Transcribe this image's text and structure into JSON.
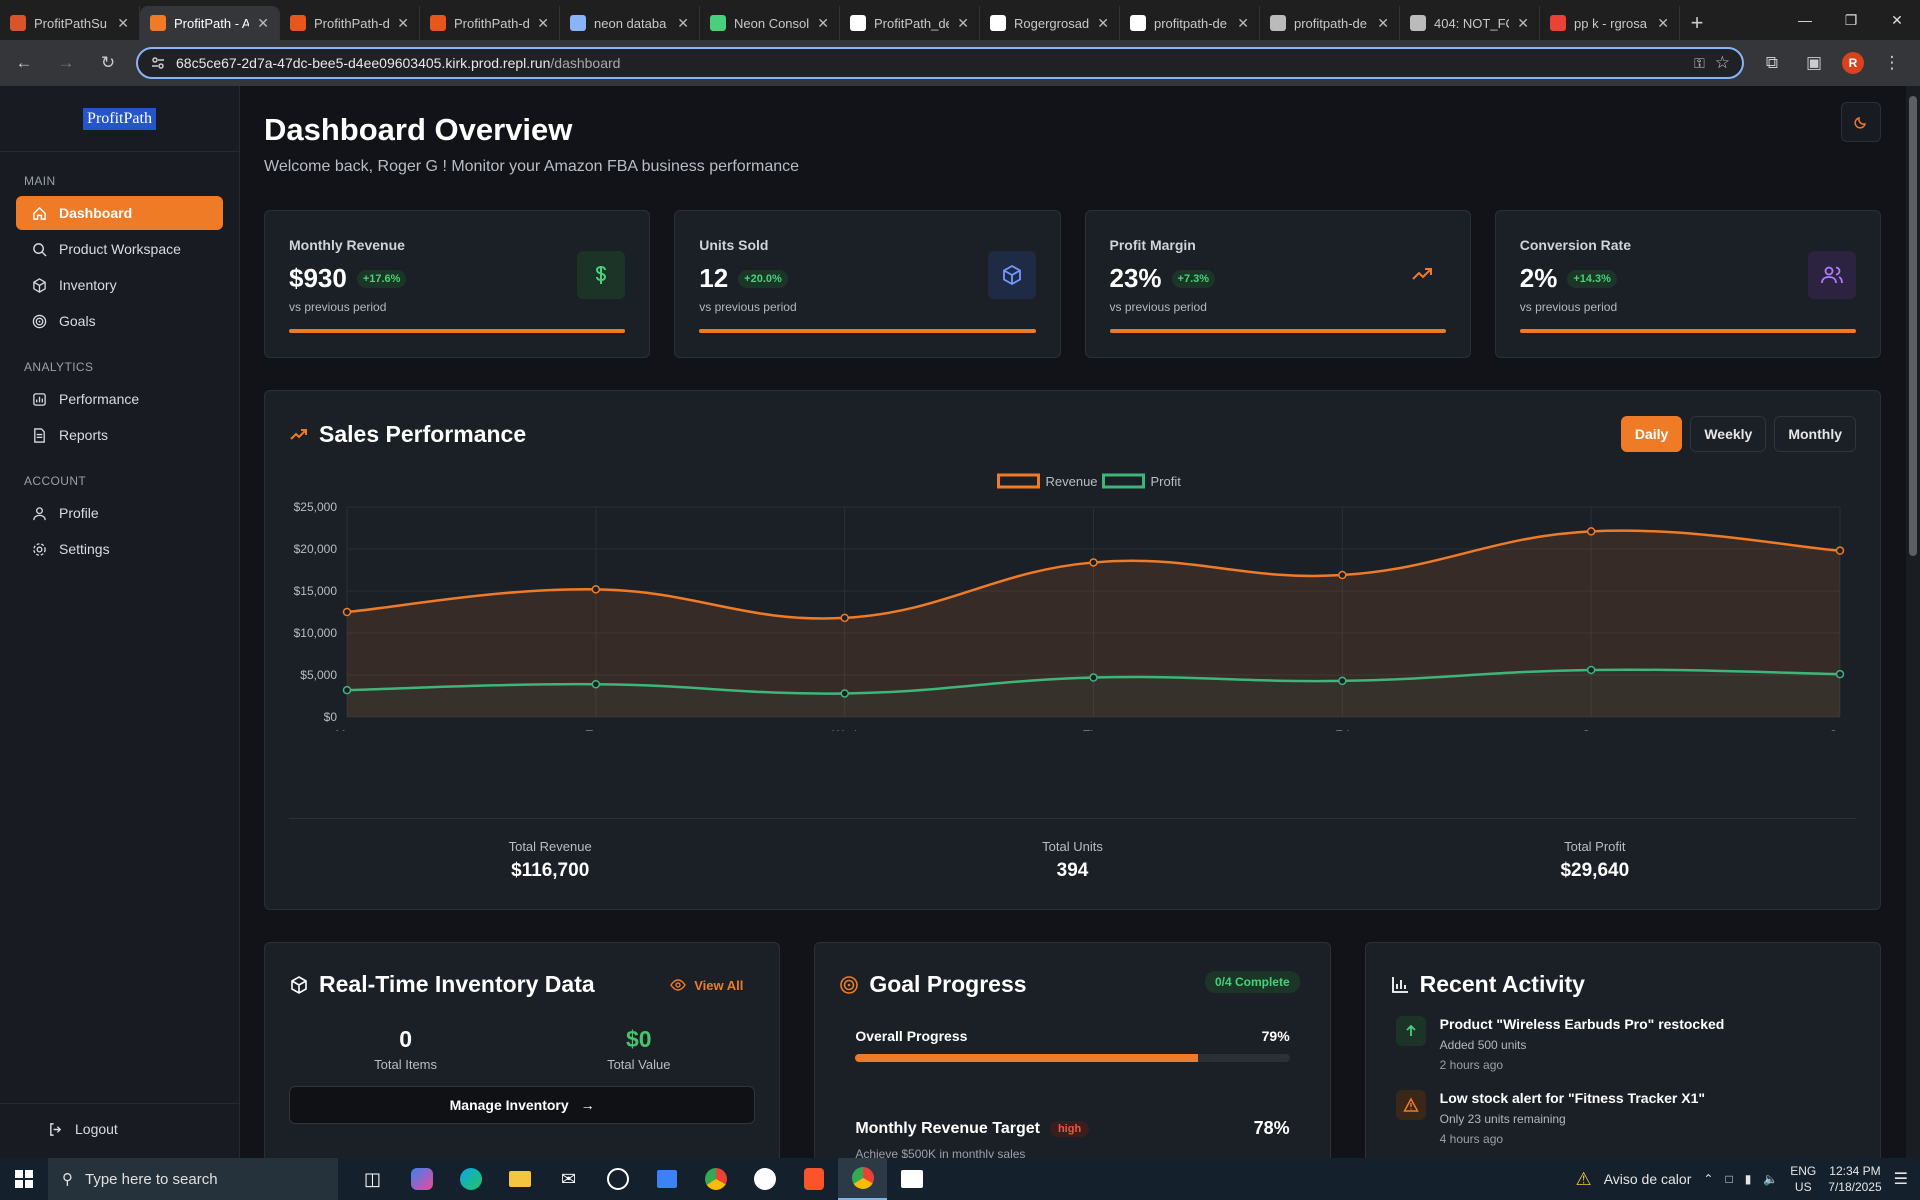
{
  "browser": {
    "tabs": [
      {
        "title": "ProfitPathSu",
        "fav": "#d9532b"
      },
      {
        "title": "ProfitPath - A",
        "fav": "#f07b27",
        "active": true
      },
      {
        "title": "ProfithPath-d",
        "fav": "#e8561b"
      },
      {
        "title": "ProfithPath-d",
        "fav": "#e8561b"
      },
      {
        "title": "neon databa",
        "fav": "#8ab4f8"
      },
      {
        "title": "Neon Consol",
        "fav": "#47d17a"
      },
      {
        "title": "ProfitPath_de",
        "fav": "#ffffff"
      },
      {
        "title": "Rogergrosad",
        "fav": "#ffffff"
      },
      {
        "title": "profitpath-de",
        "fav": "#ffffff"
      },
      {
        "title": "profitpath-de",
        "fav": "#bbbbbb"
      },
      {
        "title": "404: NOT_FO",
        "fav": "#bbbbbb"
      },
      {
        "title": "pp k - rgrosa",
        "fav": "#ea4335"
      }
    ],
    "url_host": "68c5ce67-2d7a-47dc-bee5-d4ee09603405.kirk.prod.repl.run",
    "url_path": "/dashboard",
    "profile_initial": "R"
  },
  "sidebar": {
    "logo_alt": "ProfitPath",
    "sections": [
      {
        "label": "MAIN",
        "items": [
          {
            "label": "Dashboard",
            "icon": "home-icon",
            "active": true
          },
          {
            "label": "Product Workspace",
            "icon": "search-icon"
          },
          {
            "label": "Inventory",
            "icon": "box-icon"
          },
          {
            "label": "Goals",
            "icon": "target-icon"
          }
        ]
      },
      {
        "label": "ANALYTICS",
        "items": [
          {
            "label": "Performance",
            "icon": "chart-icon"
          },
          {
            "label": "Reports",
            "icon": "document-icon"
          }
        ]
      },
      {
        "label": "ACCOUNT",
        "items": [
          {
            "label": "Profile",
            "icon": "user-icon"
          },
          {
            "label": "Settings",
            "icon": "gear-icon"
          }
        ]
      }
    ],
    "logout": "Logout"
  },
  "header": {
    "title": "Dashboard Overview",
    "subtitle": "Welcome back, Roger G ! Monitor your Amazon FBA business performance"
  },
  "stats": [
    {
      "label": "Monthly Revenue",
      "value": "$930",
      "change": "+17.6%",
      "note": "vs previous period",
      "icon": "dollar-icon",
      "icon_color": "#47d17a",
      "icon_bg": "#1c3327"
    },
    {
      "label": "Units Sold",
      "value": "12",
      "change": "+20.0%",
      "note": "vs previous period",
      "icon": "cube-icon",
      "icon_color": "#6f9bff",
      "icon_bg": "#1f2a44"
    },
    {
      "label": "Profit Margin",
      "value": "23%",
      "change": "+7.3%",
      "note": "vs previous period",
      "icon": "trend-up-icon",
      "icon_color": "#f07b27",
      "icon_bg": "#1b1f26"
    },
    {
      "label": "Conversion Rate",
      "value": "2%",
      "change": "+14.3%",
      "note": "vs previous period",
      "icon": "users-icon",
      "icon_color": "#b07cff",
      "icon_bg": "#2b2340"
    }
  ],
  "sales": {
    "title": "Sales Performance",
    "ranges": [
      "Daily",
      "Weekly",
      "Monthly"
    ],
    "active_range": "Daily",
    "totals": [
      {
        "label": "Total Revenue",
        "value": "$116,700"
      },
      {
        "label": "Total Units",
        "value": "394"
      },
      {
        "label": "Total Profit",
        "value": "$29,640"
      }
    ]
  },
  "chart_data": {
    "type": "line",
    "x": [
      "Mon",
      "Tue",
      "Wed",
      "Thu",
      "Fri",
      "Sat",
      "Sun"
    ],
    "series": [
      {
        "name": "Revenue",
        "values": [
          12500,
          15200,
          11800,
          18400,
          16900,
          22100,
          19800
        ],
        "color": "#f07b27"
      },
      {
        "name": "Profit",
        "values": [
          3200,
          3900,
          2800,
          4700,
          4300,
          5600,
          5100
        ],
        "color": "#3fb679"
      }
    ],
    "ylim": [
      0,
      25000
    ],
    "yticks": [
      "$0",
      "$5,000",
      "$10,000",
      "$15,000",
      "$20,000",
      "$25,000"
    ],
    "ytick_values": [
      0,
      5000,
      10000,
      15000,
      20000,
      25000
    ],
    "legend": "top-center",
    "grid": true
  },
  "inventory": {
    "title": "Real-Time Inventory Data",
    "view_all": "View All",
    "total_items": "0",
    "total_items_label": "Total Items",
    "total_value": "$0",
    "total_value_label": "Total Value",
    "manage": "Manage Inventory"
  },
  "goals": {
    "title": "Goal Progress",
    "badge": "0/4 Complete",
    "overall_label": "Overall Progress",
    "overall_pct": "79%",
    "overall_value": 79,
    "goal_title": "Monthly Revenue Target",
    "goal_priority": "high",
    "goal_pct": "78%",
    "goal_desc": "Achieve $500K in monthly sales"
  },
  "activity": {
    "title": "Recent Activity",
    "items": [
      {
        "title": "Product \"Wireless Earbuds Pro\" restocked",
        "detail": "Added 500 units",
        "time": "2 hours ago",
        "icon": "arrow-up-icon",
        "color": "#47d17a",
        "bg": "#1c3327"
      },
      {
        "title": "Low stock alert for \"Fitness Tracker X1\"",
        "detail": "Only 23 units remaining",
        "time": "4 hours ago",
        "icon": "warning-icon",
        "color": "#f07b27",
        "bg": "#3a2718"
      }
    ]
  },
  "taskbar": {
    "search_placeholder": "Type here to search",
    "weather": "Aviso de calor",
    "lang": "ENG",
    "region": "US",
    "time": "12:34 PM",
    "date": "7/18/2025"
  }
}
